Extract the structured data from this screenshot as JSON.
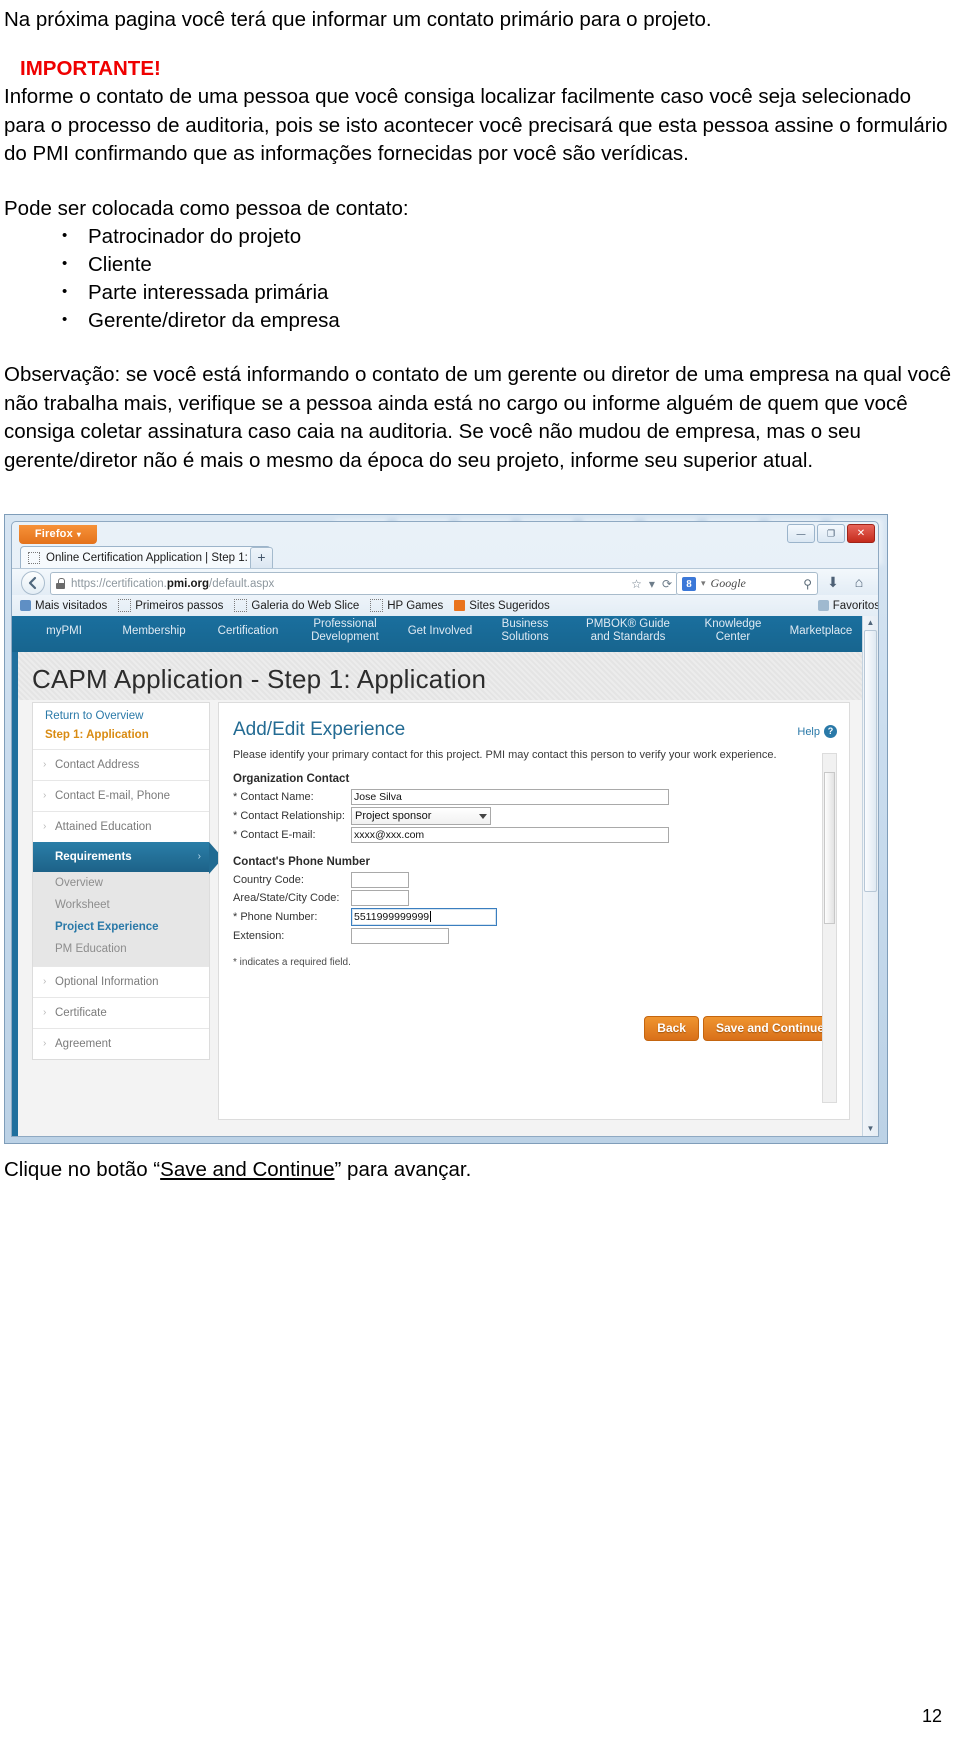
{
  "document": {
    "intro": "Na próxima pagina você terá que informar um contato primário para o projeto.",
    "important_heading": "IMPORTANTE!",
    "important_body": "Informe o contato de uma pessoa que você consiga localizar facilmente caso você seja selecionado para o processo de auditoria, pois se isto acontecer você precisará que esta pessoa assine o formulário do PMI confirmando que as informações fornecidas por você são verídicas.",
    "list_intro": "Pode ser colocada como pessoa de contato:",
    "list_items": [
      "Patrocinador do projeto",
      "Cliente",
      "Parte interessada primária",
      "Gerente/diretor da empresa"
    ],
    "observation": "Observação: se você está informando o contato de um gerente ou diretor de uma empresa na qual você não trabalha mais, verifique se a pessoa ainda está no cargo ou informe alguém de quem que você consiga coletar assinatura caso caia na auditoria. Se você não mudou de empresa, mas o seu gerente/diretor não é mais o mesmo da época do seu projeto, informe seu superior atual.",
    "caption_before": "Clique no botão “",
    "caption_link": "Save and Continue",
    "caption_after": "” para avançar.",
    "page_number": "12"
  },
  "browser": {
    "app_button": "Firefox",
    "tab_title": "Online Certification Application | Step 1: ...",
    "new_tab_label": "+",
    "url_scheme": "https://certification.",
    "url_domain": "pmi.org",
    "url_path": "/default.aspx",
    "search_engine": "Google",
    "search_logo_letter": "8",
    "window_controls": {
      "minimize": "—",
      "maximize": "❐",
      "close": "✕"
    },
    "bookmarks": [
      "Mais visitados",
      "Primeiros passos",
      "Galeria do Web Slice",
      "HP Games",
      "Sites Sugeridos"
    ],
    "favorites_label": "Favoritos"
  },
  "site": {
    "nav": [
      "myPMI",
      "Membership",
      "Certification",
      "Professional",
      "Development",
      "Get Involved",
      "Business",
      "Solutions",
      "PMBOK® Guide",
      "and Standards",
      "Knowledge",
      "Center",
      "Marketplace"
    ],
    "page_title": "CAPM Application - Step 1: Application",
    "left_nav": {
      "return_link": "Return to Overview",
      "step_label": "Step 1: Application",
      "items": [
        "Contact Address",
        "Contact E-mail, Phone",
        "Attained Education"
      ],
      "active_item": "Requirements",
      "sub_items": [
        "Overview",
        "Worksheet",
        "Project Experience",
        "PM Education"
      ],
      "active_sub_item": "Project Experience",
      "tail_items": [
        "Optional Information",
        "Certificate",
        "Agreement"
      ]
    },
    "panel": {
      "heading": "Add/Edit Experience",
      "help_label": "Help",
      "intro": "Please identify your primary contact for this project. PMI may contact this person to verify your work experience.",
      "section_contact": "Organization Contact",
      "fields": {
        "contact_name_label": "* Contact Name:",
        "contact_name_value": "Jose Silva",
        "contact_relationship_label": "* Contact Relationship:",
        "contact_relationship_value": "Project sponsor",
        "contact_email_label": "* Contact E-mail:",
        "contact_email_value": "xxxx@xxx.com"
      },
      "section_phone": "Contact's Phone Number",
      "phone_fields": {
        "country_code_label": "Country Code:",
        "country_code_value": "",
        "area_code_label": "Area/State/City Code:",
        "area_code_value": "",
        "phone_label": "* Phone Number:",
        "phone_value": "5511999999999",
        "extension_label": "Extension:",
        "extension_value": ""
      },
      "required_note": "* indicates a required field.",
      "back_button": "Back",
      "save_button": "Save and Continue"
    }
  },
  "colors": {
    "important_red": "#ef0000",
    "pmi_blue": "#1f6f9d",
    "accent_orange": "#e4721b",
    "link_blue": "#2a79a8",
    "step_orange": "#d98b12"
  }
}
